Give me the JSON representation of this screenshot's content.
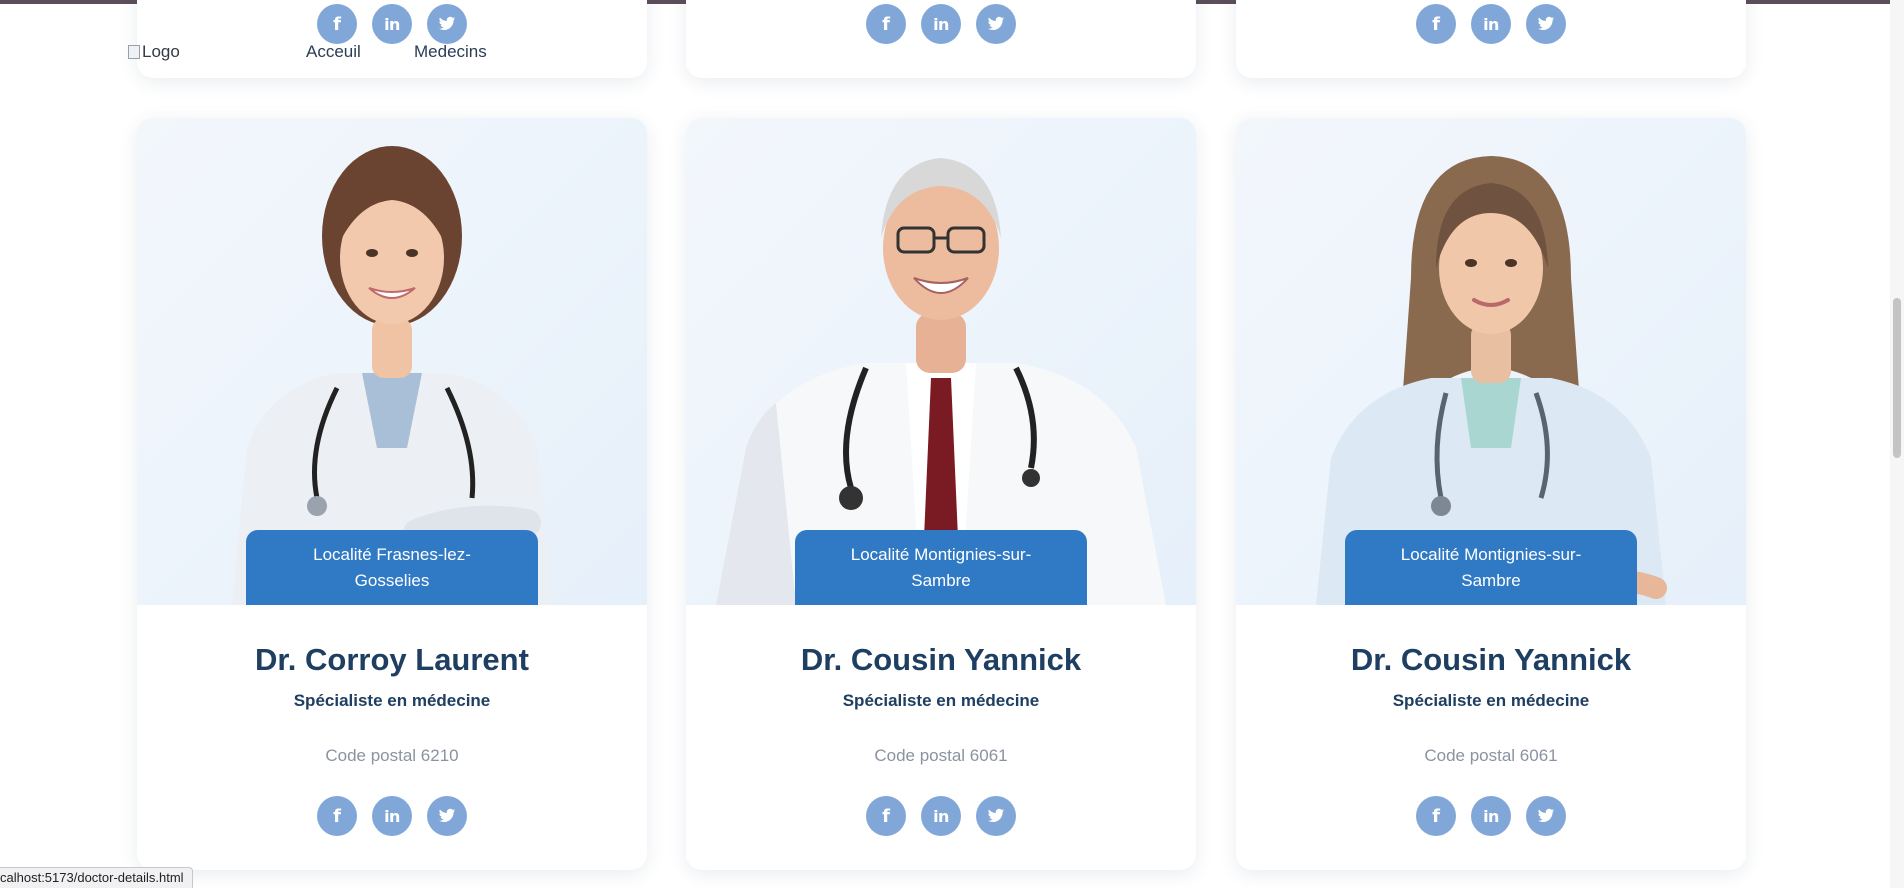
{
  "nav": {
    "logo_alt": "Logo",
    "links": [
      "Acceuil",
      "Medecins"
    ]
  },
  "social_icons": [
    "facebook-icon",
    "linkedin-icon",
    "twitter-icon"
  ],
  "colors": {
    "accent": "#2f79c5",
    "social": "#80a7d7",
    "name": "#1e3f62",
    "muted": "#8a93a0"
  },
  "doctors": [
    {
      "location": "Localité Frasnes-lez-Gosselies",
      "name": "Dr. Corroy Laurent",
      "specialty": "Spécialiste en médecine",
      "postal": "Code postal 6210"
    },
    {
      "location": "Localité Montignies-sur-Sambre",
      "name": "Dr. Cousin Yannick",
      "specialty": "Spécialiste en médecine",
      "postal": "Code postal 6061"
    },
    {
      "location": "Localité Montignies-sur-Sambre",
      "name": "Dr. Cousin Yannick",
      "specialty": "Spécialiste en médecine",
      "postal": "Code postal 6061"
    }
  ],
  "status_bar": "calhost:5173/doctor-details.html"
}
